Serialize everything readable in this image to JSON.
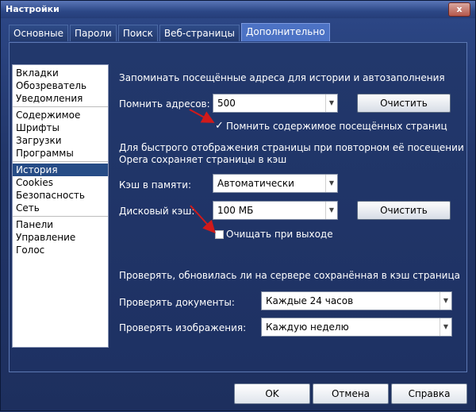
{
  "window": {
    "title": "Настройки",
    "close_label": "x"
  },
  "tabs": [
    {
      "label": "Основные",
      "active": false
    },
    {
      "label": "Пароли",
      "active": false
    },
    {
      "label": "Поиск",
      "active": false
    },
    {
      "label": "Веб-страницы",
      "active": false
    },
    {
      "label": "Дополнительно",
      "active": true
    }
  ],
  "sidebar": {
    "groups": [
      [
        "Вкладки",
        "Обозреватель",
        "Уведомления"
      ],
      [
        "Содержимое",
        "Шрифты",
        "Загрузки",
        "Программы"
      ],
      [
        "История",
        "Cookies",
        "Безопасность",
        "Сеть"
      ],
      [
        "Панели",
        "Управление",
        "Голос"
      ]
    ],
    "selected": "История"
  },
  "history": {
    "heading": "Запоминать посещённые адреса для истории и автозаполнения",
    "remember_label": "Помнить адресов:",
    "remember_value": "500",
    "clear_label": "Очистить",
    "remember_content_label": "Помнить содержимое посещённых страниц",
    "remember_content_checked": true
  },
  "cache": {
    "heading_line1": "Для быстрого отображения страницы при повторном её посещении",
    "heading_line2": "Opera сохраняет страницы в кэш",
    "memory_label": "Кэш в памяти:",
    "memory_value": "Автоматически",
    "disk_label": "Дисковый кэш:",
    "disk_value": "100 МБ",
    "clear_label": "Очистить",
    "clear_on_exit_label": "Очищать при выходе",
    "clear_on_exit_checked": false
  },
  "check": {
    "heading": "Проверять, обновилась ли на сервере сохранённая в кэш страница",
    "docs_label": "Проверять документы:",
    "docs_value": "Каждые 24 часов",
    "images_label": "Проверять изображения:",
    "images_value": "Каждую неделю"
  },
  "footer": {
    "ok": "OK",
    "cancel": "Отмена",
    "help": "Справка"
  },
  "colors": {
    "annotation_arrow": "#d11a1a",
    "selection": "#264c86"
  }
}
